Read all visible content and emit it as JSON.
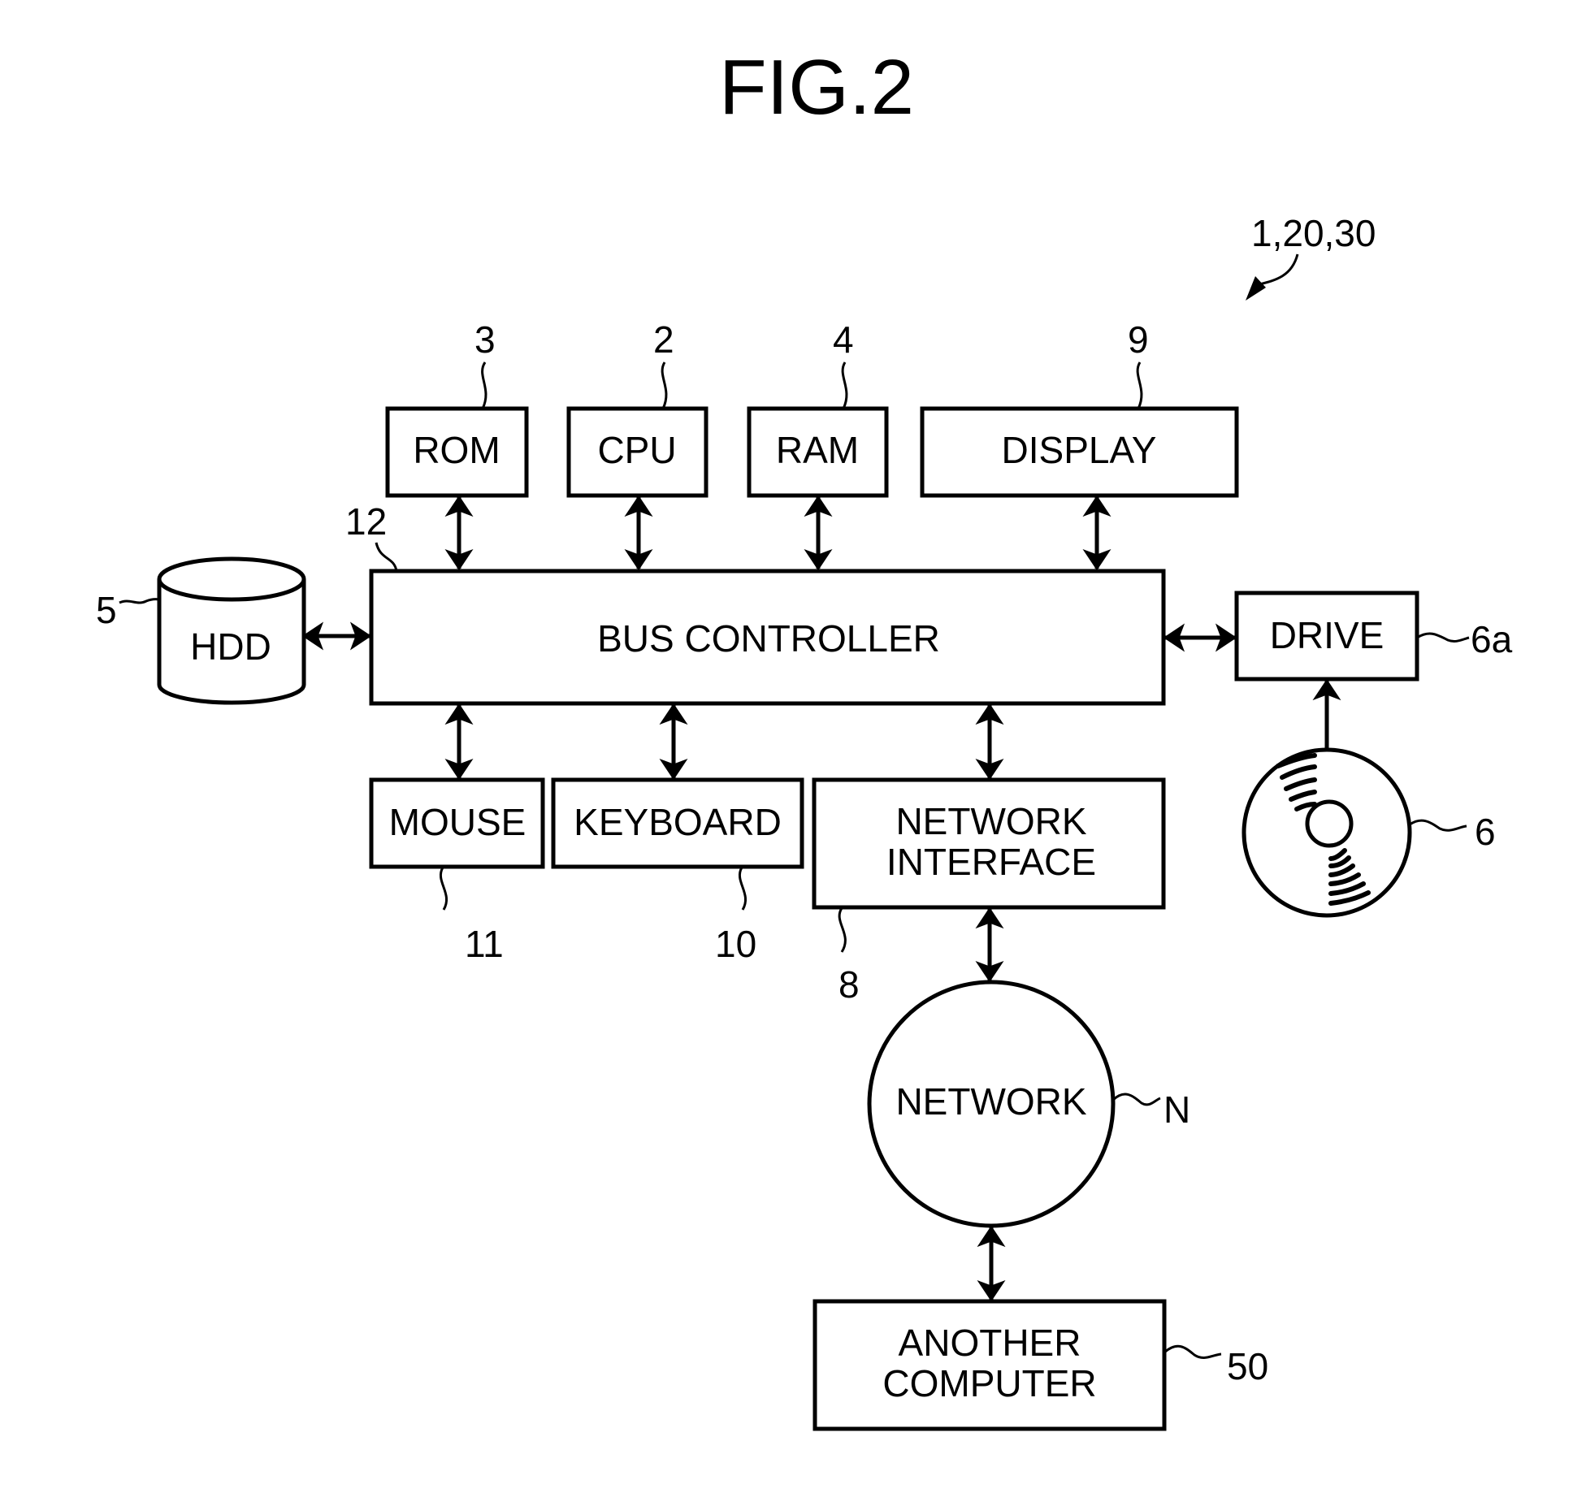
{
  "figure": {
    "title": "FIG.2",
    "reference_label": "1,20,30"
  },
  "components": {
    "rom": {
      "label": "ROM",
      "ref": "3"
    },
    "cpu": {
      "label": "CPU",
      "ref": "2"
    },
    "ram": {
      "label": "RAM",
      "ref": "4"
    },
    "display": {
      "label": "DISPLAY",
      "ref": "9"
    },
    "bus_controller": {
      "label": "BUS CONTROLLER",
      "ref": "12"
    },
    "hdd": {
      "label": "HDD",
      "ref": "5"
    },
    "drive": {
      "label": "DRIVE",
      "ref": "6a"
    },
    "disc": {
      "label": "",
      "ref": "6"
    },
    "mouse": {
      "label": "MOUSE",
      "ref": "11"
    },
    "keyboard": {
      "label": "KEYBOARD",
      "ref": "10"
    },
    "network_interface": {
      "label_line1": "NETWORK",
      "label_line2": "INTERFACE",
      "ref": "8"
    },
    "network": {
      "label": "NETWORK",
      "ref": "N"
    },
    "another_computer": {
      "label_line1": "ANOTHER",
      "label_line2": "COMPUTER",
      "ref": "50"
    }
  },
  "connections": [
    {
      "from": "ROM",
      "to": "BUS CONTROLLER",
      "type": "bidirectional"
    },
    {
      "from": "CPU",
      "to": "BUS CONTROLLER",
      "type": "bidirectional"
    },
    {
      "from": "RAM",
      "to": "BUS CONTROLLER",
      "type": "bidirectional"
    },
    {
      "from": "DISPLAY",
      "to": "BUS CONTROLLER",
      "type": "bidirectional"
    },
    {
      "from": "HDD",
      "to": "BUS CONTROLLER",
      "type": "bidirectional"
    },
    {
      "from": "BUS CONTROLLER",
      "to": "DRIVE",
      "type": "bidirectional"
    },
    {
      "from": "DISC",
      "to": "DRIVE",
      "type": "unidirectional"
    },
    {
      "from": "BUS CONTROLLER",
      "to": "MOUSE",
      "type": "bidirectional"
    },
    {
      "from": "BUS CONTROLLER",
      "to": "KEYBOARD",
      "type": "bidirectional"
    },
    {
      "from": "BUS CONTROLLER",
      "to": "NETWORK INTERFACE",
      "type": "bidirectional"
    },
    {
      "from": "NETWORK INTERFACE",
      "to": "NETWORK",
      "type": "bidirectional"
    },
    {
      "from": "NETWORK",
      "to": "ANOTHER COMPUTER",
      "type": "bidirectional"
    }
  ]
}
